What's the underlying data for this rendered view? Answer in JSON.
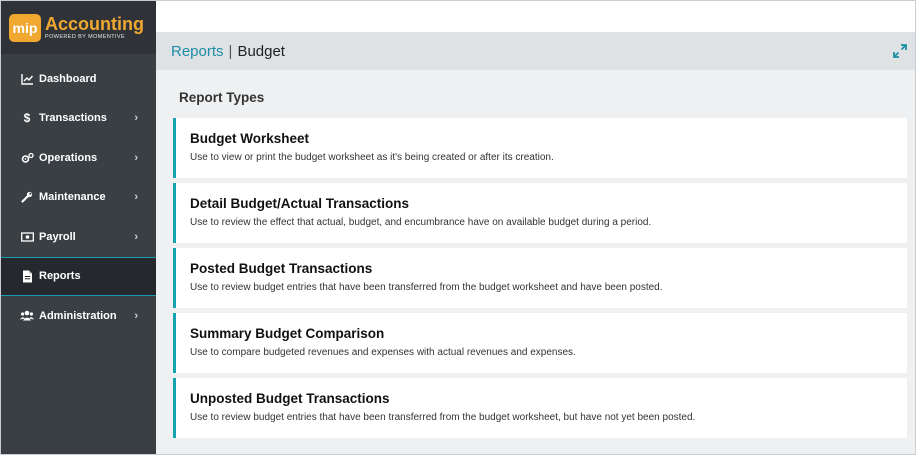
{
  "brand": {
    "badge": "mip",
    "title": "Accounting",
    "subtitle": "POWERED BY MOMENTIVE"
  },
  "colors": {
    "sidebar_bg": "#3a3f44",
    "accent_orange": "#f0a830",
    "accent_teal": "#17a2b0",
    "link_teal": "#1d8ea3"
  },
  "sidebar": {
    "items": [
      {
        "label": "Dashboard",
        "icon": "chart-line-icon",
        "has_submenu": false,
        "active": false
      },
      {
        "label": "Transactions",
        "icon": "dollar-icon",
        "has_submenu": true,
        "active": false
      },
      {
        "label": "Operations",
        "icon": "gears-icon",
        "has_submenu": true,
        "active": false
      },
      {
        "label": "Maintenance",
        "icon": "wrench-icon",
        "has_submenu": true,
        "active": false
      },
      {
        "label": "Payroll",
        "icon": "money-icon",
        "has_submenu": true,
        "active": false
      },
      {
        "label": "Reports",
        "icon": "document-icon",
        "has_submenu": false,
        "active": true
      },
      {
        "label": "Administration",
        "icon": "users-icon",
        "has_submenu": true,
        "active": false
      }
    ]
  },
  "header": {
    "breadcrumb_link": "Reports",
    "breadcrumb_sep": "|",
    "breadcrumb_current": "Budget"
  },
  "content": {
    "section_title": "Report Types",
    "reports": [
      {
        "title": "Budget Worksheet",
        "description": "Use to view or print the budget worksheet as it's being created or after its creation."
      },
      {
        "title": "Detail Budget/Actual Transactions",
        "description": "Use to review the effect that actual, budget, and encumbrance have on available budget during a period."
      },
      {
        "title": "Posted Budget Transactions",
        "description": "Use to review budget entries that have been transferred from the budget worksheet and have been posted."
      },
      {
        "title": "Summary Budget Comparison",
        "description": "Use to compare budgeted revenues and expenses with actual revenues and expenses."
      },
      {
        "title": "Unposted Budget Transactions",
        "description": "Use to review budget entries that have been transferred from the budget worksheet, but have not yet been posted."
      }
    ]
  }
}
